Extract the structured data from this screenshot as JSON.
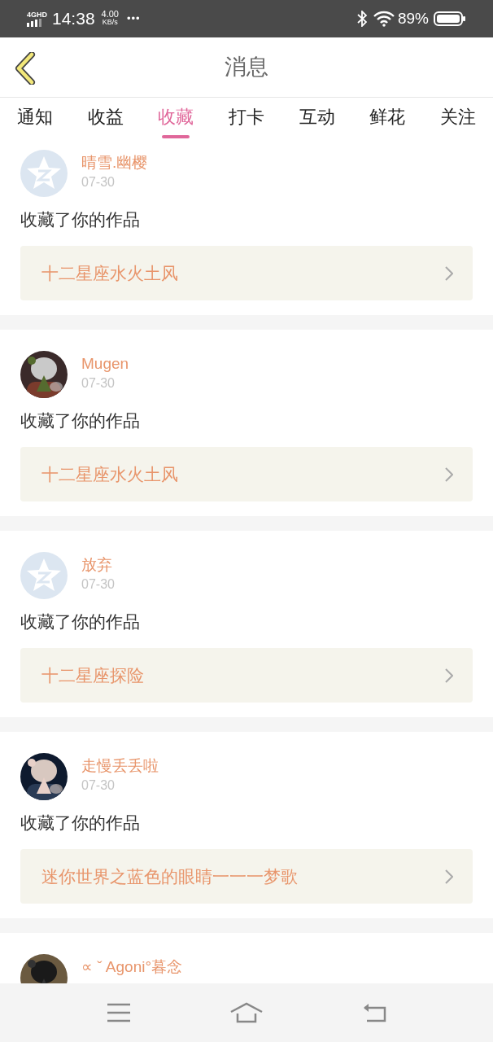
{
  "status_bar": {
    "network": "4GHD",
    "time": "14:38",
    "speed": "4.00",
    "speed_unit": "KB/s",
    "more": "•••",
    "battery": "89%"
  },
  "header": {
    "title": "消息"
  },
  "tabs": [
    {
      "label": "通知",
      "selected": false
    },
    {
      "label": "收益",
      "selected": false
    },
    {
      "label": "收藏",
      "selected": true
    },
    {
      "label": "打卡",
      "selected": false
    },
    {
      "label": "互动",
      "selected": false
    },
    {
      "label": "鲜花",
      "selected": false
    },
    {
      "label": "关注",
      "selected": false
    }
  ],
  "messages": [
    {
      "avatar": {
        "kind": "default"
      },
      "user": "晴雪.幽樱",
      "date": "07-30",
      "action": "收藏了你的作品",
      "work": "十二星座水火土风"
    },
    {
      "user": "Mugen",
      "date": "07-30",
      "action": "收藏了你的作品",
      "work": "十二星座水火土风"
    },
    {
      "avatar": {
        "kind": "default"
      },
      "user": "放弃",
      "date": "07-30",
      "action": "收藏了你的作品",
      "work": "十二星座探险"
    },
    {
      "user": "走慢丢丢啦",
      "date": "07-30",
      "action": "收藏了你的作品",
      "work": "迷你世界之蓝色的眼睛一一一梦歌"
    },
    {
      "user": "∝ ˇ Agoni°暮念"
    }
  ]
}
